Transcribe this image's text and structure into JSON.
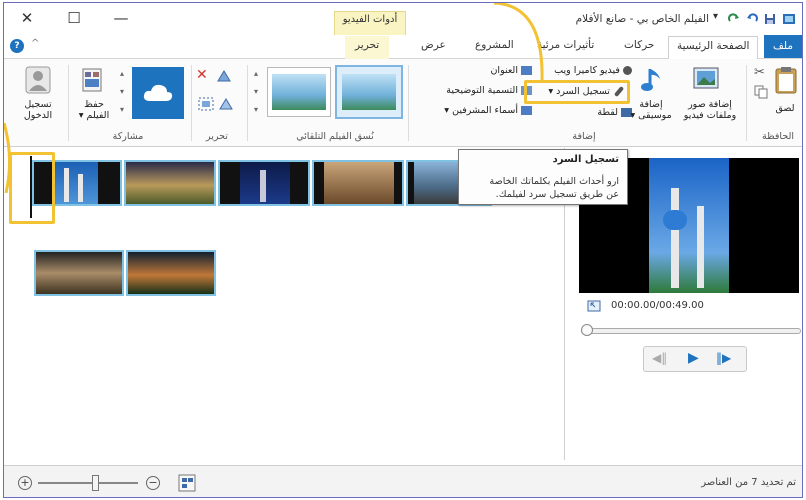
{
  "window": {
    "title": "الفيلم الخاص بي - صانع الأفلام",
    "close_glyph": "✕",
    "maximize_glyph": "☐",
    "minimize_glyph": "—"
  },
  "contextual_tab": {
    "label": "أدوات الفيديو"
  },
  "tabs": [
    {
      "label": "ملف"
    },
    {
      "label": "الصفحة الرئيسية"
    },
    {
      "label": "حركات"
    },
    {
      "label": "تأثيرات مرئية"
    },
    {
      "label": "المشروع"
    },
    {
      "label": "عرض"
    },
    {
      "label": "تحرير"
    }
  ],
  "ribbon": {
    "clipboard": {
      "label": "الحافظة",
      "paste": "لصق"
    },
    "add": {
      "label": "إضافة",
      "add_videos_photos_line1": "إضافة صور",
      "add_videos_photos_line2": "وملفات فيديو",
      "add_music_line1": "إضافة",
      "add_music_line2": "موسيقى",
      "webcam_video": "فيديو كاميرا ويب",
      "record_narration": "تسجيل السرد",
      "snapshot": "لقطة",
      "title": "العنوان",
      "caption": "التسمية التوضيحية",
      "credits": "أسماء المشرفين"
    },
    "automovie": {
      "label": "نُسق الفيلم التلقائي"
    },
    "editing": {
      "label": "تحرير"
    },
    "sharing": {
      "label": "مشاركة",
      "save_line1": "حفظ",
      "save_line2": "الفيلم"
    },
    "signin": {
      "line1": "تسجيل",
      "line2": "الدخول"
    }
  },
  "tooltip": {
    "title": "تسجيل السرد",
    "body_line1": "ارو أحداث الفيلم بكلماتك الخاصة",
    "body_line2": "عن طريق تسجيل سرد لفيلمك."
  },
  "preview": {
    "timecode": "00:00.00/00:49.00"
  },
  "status": {
    "text": "تم تحديد 7 من العناصر"
  },
  "colors": {
    "frame": "#6a6cc0",
    "file_tab": "#1e73be",
    "highlight": "#f2c232",
    "clip_border": "#7fc2e4",
    "contextual_tab": "#f9f4c1"
  },
  "icons": [
    "close-icon",
    "maximize-icon",
    "minimize-icon",
    "save-icon",
    "undo-icon",
    "redo-icon",
    "help-icon",
    "collapse-icon",
    "paste-icon",
    "cut-icon",
    "copy-icon",
    "add-videos-photos-icon",
    "add-music-icon",
    "webcam-icon",
    "microphone-icon",
    "snapshot-icon",
    "title-icon",
    "caption-icon",
    "credits-icon",
    "remove-icon",
    "rotate-left-icon",
    "rotate-right-icon",
    "select-all-icon",
    "onedrive-icon",
    "save-movie-icon",
    "user-icon",
    "play-icon",
    "previous-frame-icon",
    "next-frame-icon",
    "fullscreen-icon",
    "zoom-in-icon",
    "zoom-out-icon",
    "thumbnail-size-icon"
  ]
}
